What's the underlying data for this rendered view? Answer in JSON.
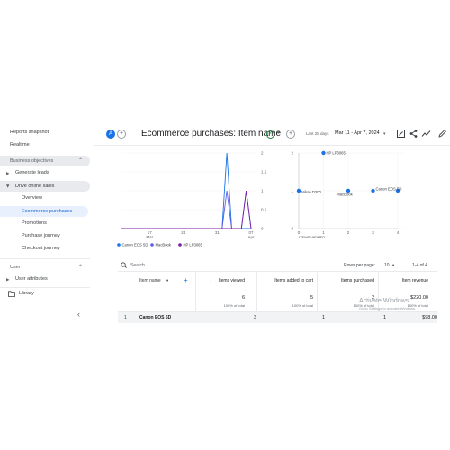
{
  "sidebar": {
    "top_items": [
      "Reports snapshot",
      "Realtime"
    ],
    "section_business": "Business objectives",
    "items": {
      "generate_leads": "Generate leads",
      "drive_online_sales": "Drive online sales",
      "overview": "Overview",
      "ecommerce_purchases": "Ecommerce purchases",
      "promotions": "Promotions",
      "purchase_journey": "Purchase journey",
      "checkout_journey": "Checkout journey"
    },
    "section_user": "User",
    "user_attributes": "User attributes",
    "library": "Library"
  },
  "header": {
    "avatar_letter": "A",
    "title": "Ecommerce purchases: Item name",
    "date_label": "Last 28 days",
    "date_range": "Mar 11 - Apr 7, 2024"
  },
  "colors": {
    "accent": "#1a73e8",
    "canon": "#1a73e8",
    "macbook": "#5e5ce6",
    "hp": "#7b1fa2",
    "active_bg": "#e8f0fe"
  },
  "chart_data": [
    {
      "type": "line",
      "x": [
        "Mar 11",
        "Mar 12",
        "Mar 13",
        "Mar 14",
        "Mar 15",
        "Mar 16",
        "Mar 17",
        "Mar 18",
        "Mar 19",
        "Mar 20",
        "Mar 21",
        "Mar 22",
        "Mar 23",
        "Mar 24",
        "Mar 25",
        "Mar 26",
        "Mar 27",
        "Mar 28",
        "Mar 29",
        "Mar 30",
        "Mar 31",
        "Apr 01",
        "Apr 02",
        "Apr 03",
        "Apr 04",
        "Apr 05",
        "Apr 06",
        "Apr 07"
      ],
      "x_tick_labels": [
        "17",
        "24",
        "31",
        "07"
      ],
      "x_tick_sublabels": [
        "Mar",
        "",
        "",
        "Apr"
      ],
      "y_ticks": [
        "0",
        "0.5",
        "1",
        "1.5",
        "2"
      ],
      "ylim": [
        0,
        2
      ],
      "series": [
        {
          "name": "Canon EOS 5D",
          "values": [
            0,
            0,
            0,
            0,
            0,
            0,
            0,
            0,
            0,
            0,
            0,
            0,
            0,
            0,
            0,
            0,
            0,
            0,
            0,
            0,
            0,
            0,
            2,
            0,
            0,
            0,
            0,
            0
          ]
        },
        {
          "name": "MacBook",
          "values": [
            0,
            0,
            0,
            0,
            0,
            0,
            0,
            0,
            0,
            0,
            0,
            0,
            0,
            0,
            0,
            0,
            0,
            0,
            0,
            0,
            0,
            0,
            1,
            0,
            0,
            0,
            1,
            0
          ]
        },
        {
          "name": "HP LP3065",
          "values": [
            0,
            0,
            0,
            0,
            0,
            0,
            0,
            0,
            0,
            0,
            0,
            0,
            0,
            0,
            0,
            0,
            0,
            0,
            0,
            0,
            0,
            0,
            0,
            0,
            0,
            0,
            1,
            0
          ]
        }
      ]
    },
    {
      "type": "scatter",
      "xlabel": "ITEMS VIEWED",
      "x_ticks": [
        "0",
        "1",
        "2",
        "3",
        "4"
      ],
      "y_ticks": [
        "2",
        "1",
        "0"
      ],
      "xlim": [
        0,
        4
      ],
      "ylim": [
        0,
        2
      ],
      "points": [
        {
          "label": "HP LP3065",
          "x": 1,
          "y": 2
        },
        {
          "label": "Nikon D300",
          "x": 0,
          "y": 1
        },
        {
          "label": "MacBook",
          "x": 2,
          "y": 1
        },
        {
          "label": "Canon EOS 5D",
          "x": 3,
          "y": 1
        },
        {
          "label": "",
          "x": 4,
          "y": 1
        }
      ]
    }
  ],
  "table": {
    "search_placeholder": "Search...",
    "rows_per_page_label": "Rows per page:",
    "rows_per_page_value": "10",
    "pagination": "1-4 of 4",
    "dimension_header": "Item name",
    "columns": [
      {
        "header": "Items viewed",
        "total": "6",
        "sub": "100% of total"
      },
      {
        "header": "Items added to cart",
        "total": "5",
        "sub": "100% of total"
      },
      {
        "header": "Items purchased",
        "total": "2",
        "sub": "100% of total"
      },
      {
        "header": "Item revenue",
        "total": "$220.00",
        "sub": "100% of total"
      }
    ],
    "rows": [
      {
        "index": "1",
        "name": "Canon EOS 5D",
        "values": [
          "3",
          "1",
          "1",
          "$98.00"
        ]
      }
    ]
  },
  "watermark": {
    "line1": "Activate Windows",
    "line2": "Go to Settings to activate Windows."
  }
}
